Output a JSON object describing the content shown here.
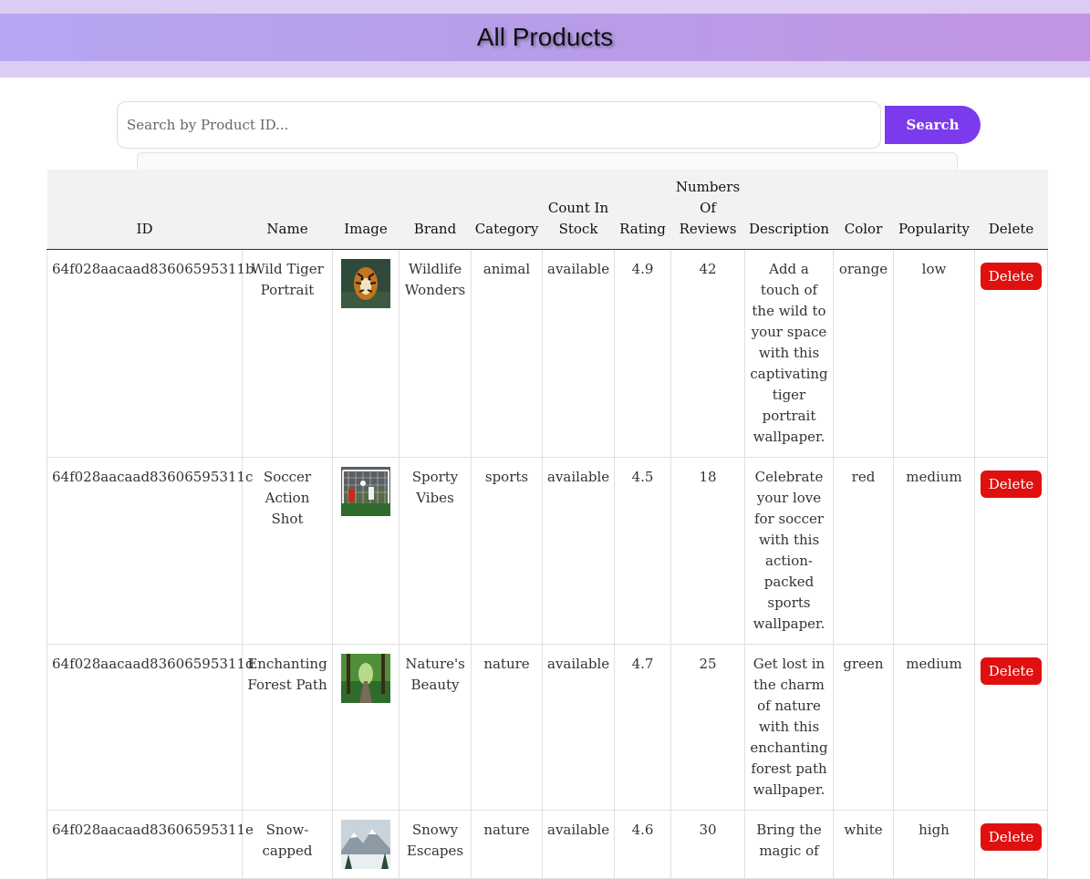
{
  "header": {
    "title": "All Products"
  },
  "search": {
    "placeholder": "Search by Product ID...",
    "button_label": "Search"
  },
  "table": {
    "columns": [
      "ID",
      "Name",
      "Image",
      "Brand",
      "Category",
      "Count In Stock",
      "Rating",
      "Numbers Of Reviews",
      "Description",
      "Color",
      "Popularity",
      "Delete"
    ],
    "delete_label": "Delete",
    "rows": [
      {
        "id": "64f028aacaad83606595311b",
        "name": "Wild Tiger Portrait",
        "image": "tiger-image",
        "brand": "Wildlife Wonders",
        "category": "animal",
        "stock": "available",
        "rating": "4.9",
        "reviews": "42",
        "description": "Add a touch of the wild to your space with this captivating tiger portrait wallpaper.",
        "color": "orange",
        "popularity": "low"
      },
      {
        "id": "64f028aacaad83606595311c",
        "name": "Soccer Action Shot",
        "image": "soccer-image",
        "brand": "Sporty Vibes",
        "category": "sports",
        "stock": "available",
        "rating": "4.5",
        "reviews": "18",
        "description": "Celebrate your love for soccer with this action-packed sports wallpaper.",
        "color": "red",
        "popularity": "medium"
      },
      {
        "id": "64f028aacaad83606595311d",
        "name": "Enchanting Forest Path",
        "image": "forest-image",
        "brand": "Nature's Beauty",
        "category": "nature",
        "stock": "available",
        "rating": "4.7",
        "reviews": "25",
        "description": "Get lost in the charm of nature with this enchanting forest path wallpaper.",
        "color": "green",
        "popularity": "medium"
      },
      {
        "id": "64f028aacaad83606595311e",
        "name": "Snow-capped",
        "image": "mountain-image",
        "brand": "Snowy Escapes",
        "category": "nature",
        "stock": "available",
        "rating": "4.6",
        "reviews": "30",
        "description": "Bring the magic of",
        "color": "white",
        "popularity": "high"
      }
    ]
  }
}
